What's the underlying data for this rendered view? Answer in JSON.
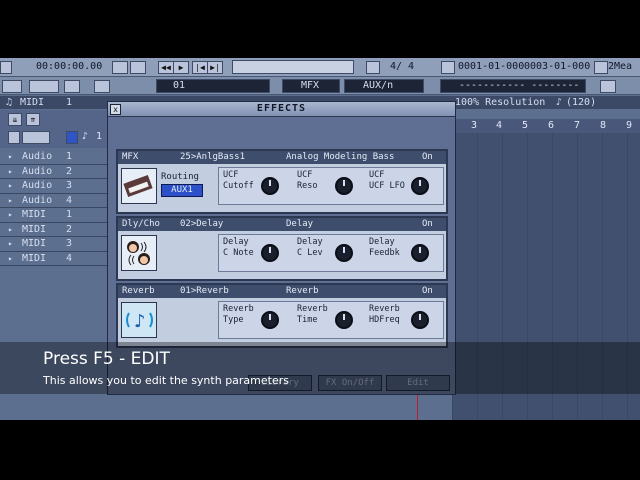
{
  "toolbar": {
    "time": "00:00:00.00",
    "transport_counter": "4/ 4",
    "position": "0001-01-000",
    "end_position": "0003-01-000",
    "measure_suffix": "2Mea",
    "dashes": "----------- ---------",
    "track_field": "01",
    "mfx_label": "MFX",
    "aux_label": "AUX/n",
    "resolution_label": "100% Resolution",
    "resolution_value": "(120)"
  },
  "track_header": {
    "label": "MIDI",
    "num": "1"
  },
  "tracks": [
    {
      "name": "Audio",
      "num": "1"
    },
    {
      "name": "Audio",
      "num": "2"
    },
    {
      "name": "Audio",
      "num": "3"
    },
    {
      "name": "Audio",
      "num": "4"
    },
    {
      "name": "MIDI",
      "num": "1"
    },
    {
      "name": "MIDI",
      "num": "2"
    },
    {
      "name": "MIDI",
      "num": "3"
    },
    {
      "name": "MIDI",
      "num": "4"
    }
  ],
  "ruler": [
    "3",
    "4",
    "5",
    "6",
    "7",
    "8",
    "9"
  ],
  "effects": {
    "title": "EFFECTS",
    "close": "x",
    "mfx": {
      "slot": "MFX",
      "preset": "25>AnlgBass1",
      "name": "Analog Modeling Bass",
      "state": "On",
      "routing_label": "Routing",
      "routing_value": "AUX1",
      "params": [
        {
          "l1": "UCF",
          "l2": "Cutoff"
        },
        {
          "l1": "UCF",
          "l2": "Reso"
        },
        {
          "l1": "UCF",
          "l2": "UCF LFO"
        }
      ]
    },
    "dly": {
      "slot": "Dly/Cho",
      "preset": "02>Delay",
      "name": "Delay",
      "state": "On",
      "params": [
        {
          "l1": "Delay",
          "l2": "C Note"
        },
        {
          "l1": "Delay",
          "l2": "C Lev"
        },
        {
          "l1": "Delay",
          "l2": "Feedbk"
        }
      ]
    },
    "rev": {
      "slot": "Reverb",
      "preset": "01>Reverb",
      "name": "Reverb",
      "state": "On",
      "params": [
        {
          "l1": "Reverb",
          "l2": "Type"
        },
        {
          "l1": "Reverb",
          "l2": "Time"
        },
        {
          "l1": "Reverb",
          "l2": "HDFreq"
        }
      ]
    },
    "buttons": {
      "library": "Library",
      "fx_onoff": "FX On/Off",
      "edit": "Edit"
    }
  },
  "caption": {
    "title": "Press F5 - EDIT",
    "subtitle": "This allows you to edit the synth parameters"
  }
}
